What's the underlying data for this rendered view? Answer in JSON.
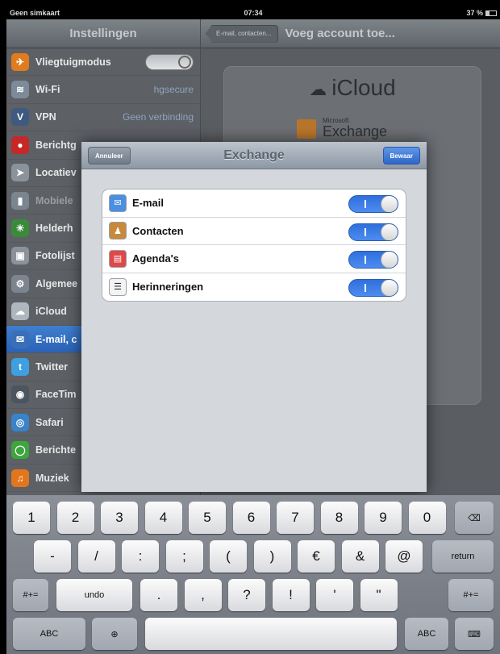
{
  "status": {
    "carrier": "Geen simkaart",
    "time": "07:34",
    "battery": "37 %"
  },
  "settings": {
    "title": "Instellingen",
    "items": [
      {
        "label": "Vliegtuigmodus",
        "value": "",
        "icon": "airplane-icon",
        "color": "#e07b1f"
      },
      {
        "label": "Wi-Fi",
        "value": "hgsecure",
        "icon": "wifi-icon",
        "color": "#7c8a99"
      },
      {
        "label": "VPN",
        "value": "Geen verbinding",
        "icon": "vpn-icon",
        "color": "#3f5a80"
      },
      {
        "label": "Berichtg",
        "value": "",
        "icon": "notifications-icon",
        "color": "#c62828"
      },
      {
        "label": "Locatiev",
        "value": "",
        "icon": "location-icon",
        "color": "#8a939c"
      },
      {
        "label": "Mobiele",
        "value": "",
        "icon": "cellular-icon",
        "color": "#7b8590"
      },
      {
        "label": "Helderh",
        "value": "",
        "icon": "brightness-icon",
        "color": "#3b8a3b"
      },
      {
        "label": "Fotolijst",
        "value": "",
        "icon": "picture-frame-icon",
        "color": "#8a939c"
      },
      {
        "label": "Algemee",
        "value": "",
        "icon": "gear-icon",
        "color": "#7b8590"
      },
      {
        "label": "iCloud",
        "value": "",
        "icon": "cloud-icon",
        "color": "#aeb6bf"
      },
      {
        "label": "E-mail, c",
        "value": "",
        "icon": "mail-icon",
        "color": "#3a6fb8"
      },
      {
        "label": "Twitter",
        "value": "",
        "icon": "twitter-icon",
        "color": "#3ea0e0"
      },
      {
        "label": "FaceTim",
        "value": "",
        "icon": "facetime-icon",
        "color": "#4a5560"
      },
      {
        "label": "Safari",
        "value": "",
        "icon": "safari-icon",
        "color": "#3a82c9"
      },
      {
        "label": "Berichte",
        "value": "",
        "icon": "messages-icon",
        "color": "#3da63d"
      },
      {
        "label": "Muziek",
        "value": "",
        "icon": "music-icon",
        "color": "#e2761d"
      }
    ]
  },
  "add_account": {
    "back_label": "E-mail, contacten...",
    "title": "Voeg account toe...",
    "providers": {
      "icloud": "iCloud",
      "ms": "Microsoft",
      "exchange": "Exchange"
    }
  },
  "exchange": {
    "title": "Exchange",
    "cancel": "Annuleer",
    "save": "Bewaar",
    "rows": [
      {
        "label": "E-mail",
        "icon": "mail-icon",
        "on": true
      },
      {
        "label": "Contacten",
        "icon": "contacts-icon",
        "on": true
      },
      {
        "label": "Agenda's",
        "icon": "calendar-icon",
        "on": true
      },
      {
        "label": "Herinneringen",
        "icon": "reminders-icon",
        "on": true
      }
    ]
  },
  "keyboard": {
    "row1": [
      "1",
      "2",
      "3",
      "4",
      "5",
      "6",
      "7",
      "8",
      "9",
      "0"
    ],
    "backspace_glyph": "⌫",
    "row2": [
      "-",
      "/",
      ":",
      ";",
      "(",
      ")",
      "€",
      "&",
      "@"
    ],
    "return": "return",
    "row3": [
      "undo",
      ".",
      ",",
      "?",
      "!",
      "'",
      "\""
    ],
    "symbols": "#+=",
    "abc": "ABC",
    "globe_glyph": "⊕",
    "dismiss_glyph": "⌨"
  }
}
